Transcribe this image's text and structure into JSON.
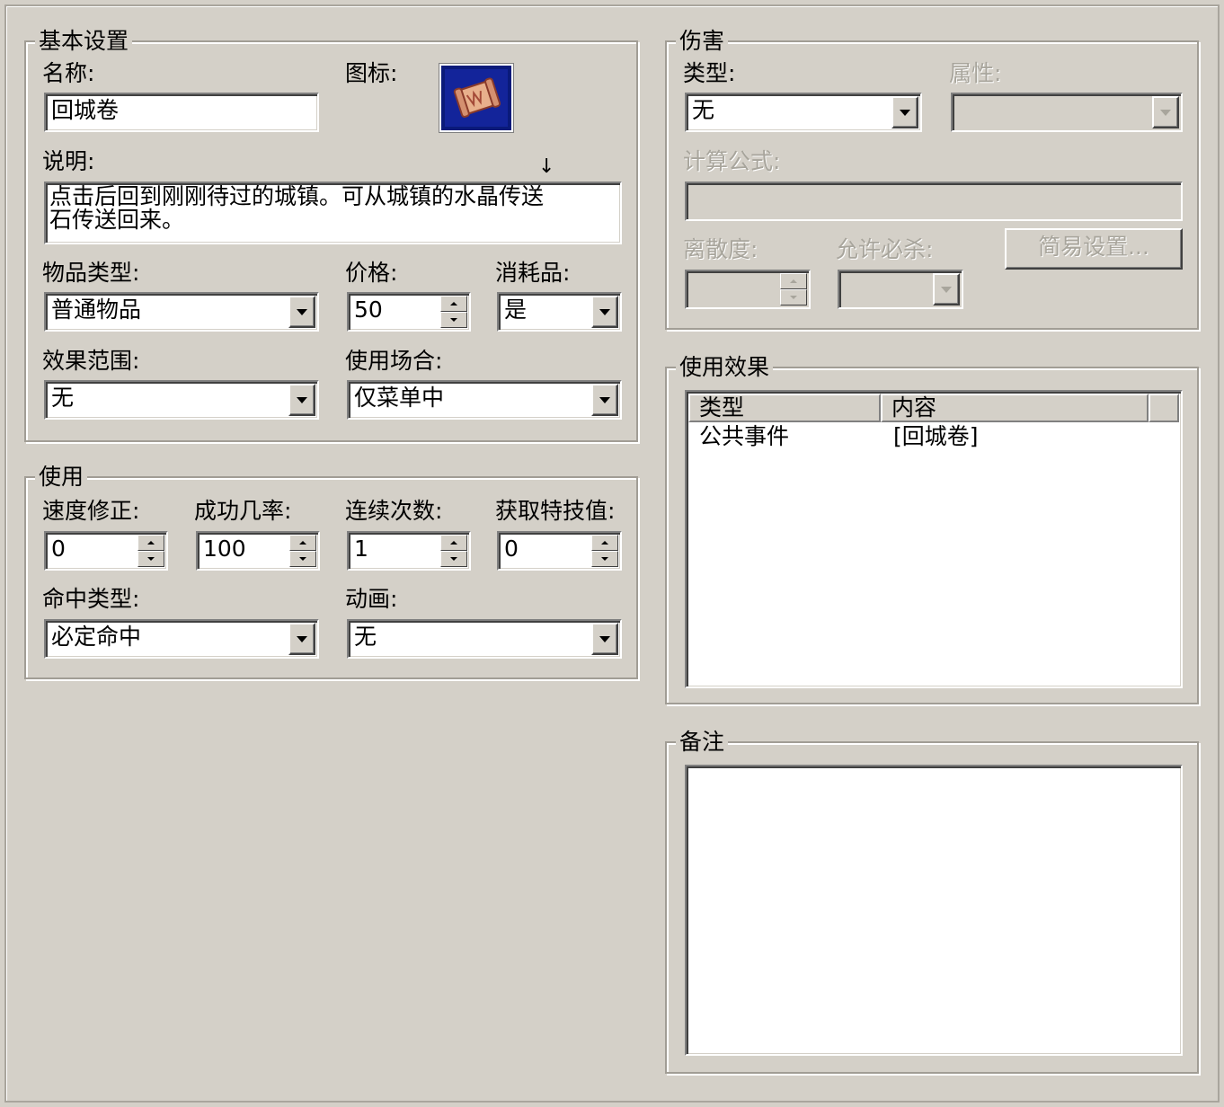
{
  "basic": {
    "legend": "基本设置",
    "name_label": "名称:",
    "name_value": "回城卷",
    "icon_label": "图标:",
    "icon_name": "scroll-icon",
    "desc_label": "说明:",
    "desc_value": "点击后回到刚刚待过的城镇。可从城镇的水晶传送石传送回来。",
    "item_type_label": "物品类型:",
    "item_type_value": "普通物品",
    "price_label": "价格:",
    "price_value": "50",
    "consumable_label": "消耗品:",
    "consumable_value": "是",
    "scope_label": "效果范围:",
    "scope_value": "无",
    "occasion_label": "使用场合:",
    "occasion_value": "仅菜单中"
  },
  "usage": {
    "legend": "使用",
    "speed_label": "速度修正:",
    "speed_value": "0",
    "success_label": "成功几率:",
    "success_value": "100",
    "repeat_label": "连续次数:",
    "repeat_value": "1",
    "tp_label": "获取特技值:",
    "tp_value": "0",
    "hit_type_label": "命中类型:",
    "hit_type_value": "必定命中",
    "animation_label": "动画:",
    "animation_value": "无"
  },
  "damage": {
    "legend": "伤害",
    "type_label": "类型:",
    "type_value": "无",
    "element_label": "属性:",
    "element_value": "",
    "formula_label": "计算公式:",
    "formula_value": "",
    "variance_label": "离散度:",
    "variance_value": "",
    "critical_label": "允许必杀:",
    "critical_value": "",
    "easy_button": "简易设置..."
  },
  "effects": {
    "legend": "使用效果",
    "columns": [
      "类型",
      "内容"
    ],
    "rows": [
      {
        "type": "公共事件",
        "content": "[回城卷]"
      }
    ]
  },
  "notes": {
    "legend": "备注",
    "value": ""
  },
  "colors": {
    "window_bg": "#d4d0c8",
    "disabled_text": "#a8a59c",
    "icon_bg": "#0a1a7a"
  }
}
